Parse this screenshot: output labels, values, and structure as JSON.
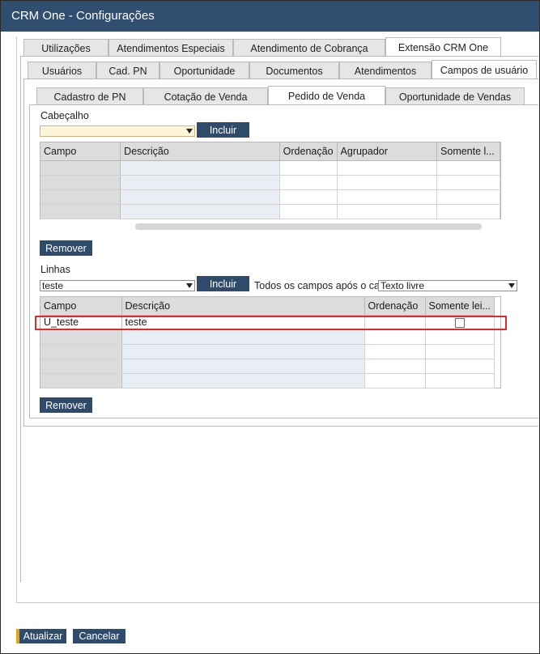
{
  "window": {
    "title": "CRM One - Configurações"
  },
  "tabs_level1": [
    {
      "label": "Utilizações",
      "active": false
    },
    {
      "label": "Atendimentos Especiais",
      "active": false
    },
    {
      "label": "Atendimento de Cobrança",
      "active": false
    },
    {
      "label": "Extensão CRM One",
      "active": true
    }
  ],
  "tabs_level2": [
    {
      "label": "Usuários",
      "active": false
    },
    {
      "label": "Cad. PN",
      "active": false
    },
    {
      "label": "Oportunidade",
      "active": false
    },
    {
      "label": "Documentos",
      "active": false
    },
    {
      "label": "Atendimentos",
      "active": false
    },
    {
      "label": "Campos de usuário",
      "active": true
    }
  ],
  "tabs_level3": [
    {
      "label": "Cadastro de PN",
      "active": false
    },
    {
      "label": "Cotação de Venda",
      "active": false
    },
    {
      "label": "Pedido de Venda",
      "active": true
    },
    {
      "label": "Oportunidade de Vendas",
      "active": false
    }
  ],
  "header_section": {
    "label": "Cabeçalho",
    "combo_value": "",
    "include_label": "Incluir",
    "remove_label": "Remover",
    "columns": [
      "Campo",
      "Descrição",
      "Ordenação",
      "Agrupador",
      "Somente l..."
    ],
    "rows": [
      [
        "",
        "",
        "",
        "",
        ""
      ],
      [
        "",
        "",
        "",
        "",
        ""
      ],
      [
        "",
        "",
        "",
        "",
        ""
      ],
      [
        "",
        "",
        "",
        "",
        ""
      ]
    ]
  },
  "lines_section": {
    "label": "Linhas",
    "combo_value": "teste",
    "include_label": "Incluir",
    "after_label": "Todos os campos após o ca",
    "after_combo_value": "Texto livre",
    "remove_label": "Remover",
    "columns": [
      "Campo",
      "Descrição",
      "Ordenação",
      "Somente lei..."
    ],
    "rows": [
      {
        "campo": "U_teste",
        "descricao": "teste",
        "ordenacao": "",
        "somente_leitura": false
      },
      {
        "campo": "",
        "descricao": "",
        "ordenacao": "",
        "somente_leitura": null
      },
      {
        "campo": "",
        "descricao": "",
        "ordenacao": "",
        "somente_leitura": null
      },
      {
        "campo": "",
        "descricao": "",
        "ordenacao": "",
        "somente_leitura": null
      },
      {
        "campo": "",
        "descricao": "",
        "ordenacao": "",
        "somente_leitura": null
      }
    ]
  },
  "footer": {
    "update_label": "Atualizar",
    "cancel_label": "Cancelar"
  },
  "colors": {
    "titlebar": "#304e6f",
    "button": "#2f4b6b",
    "highlight": "#e02b2b",
    "accent": "#e5a21c"
  }
}
